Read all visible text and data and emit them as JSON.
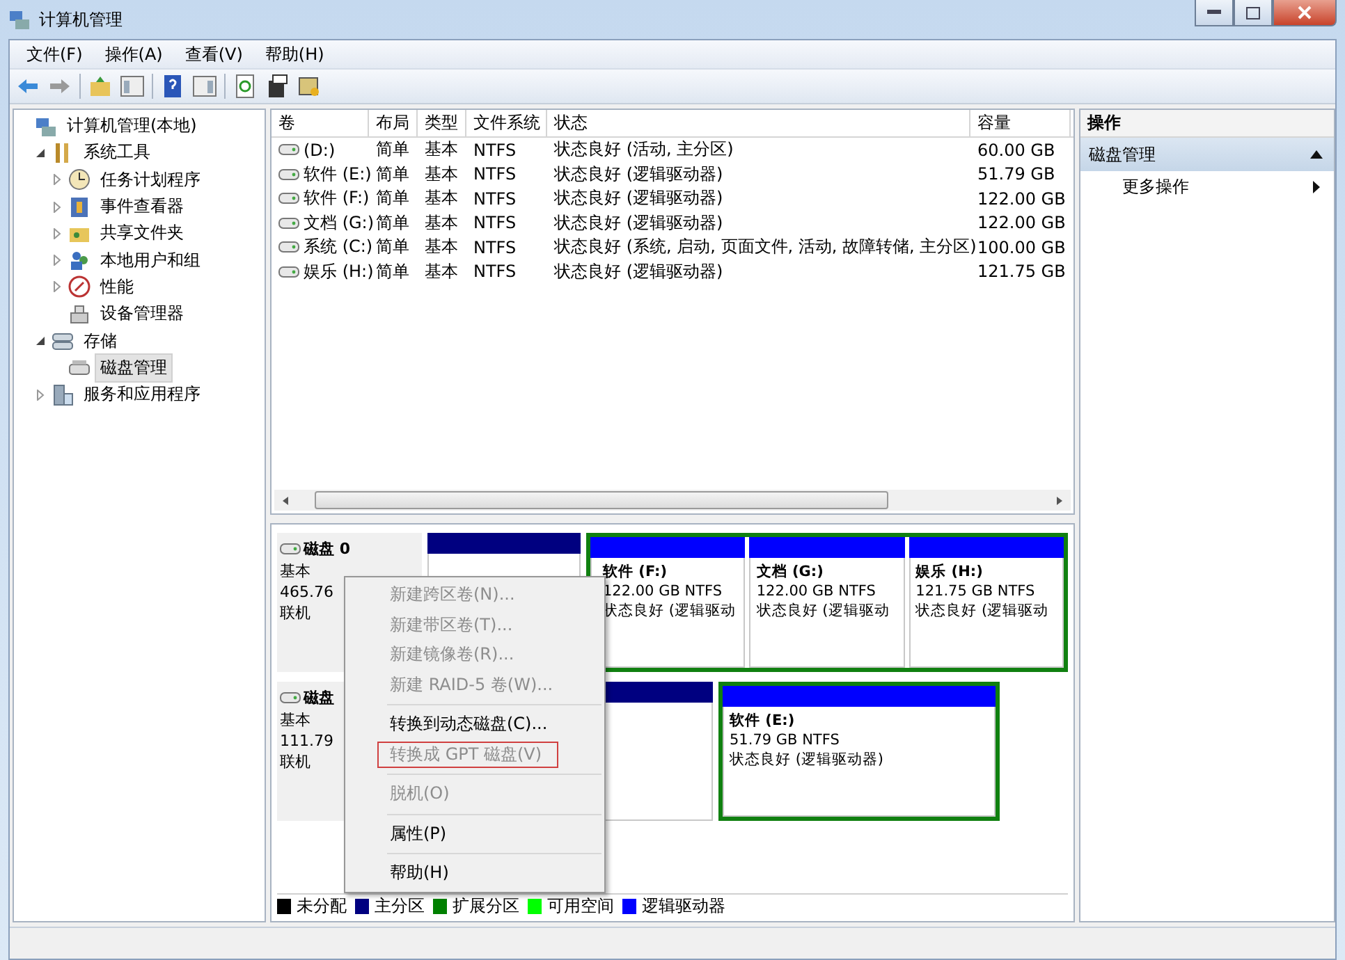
{
  "window": {
    "title": "计算机管理"
  },
  "menu_bar": [
    "文件(F)",
    "操作(A)",
    "查看(V)",
    "帮助(H)"
  ],
  "tree": [
    {
      "label": "计算机管理(本地)",
      "selected": false,
      "children": [
        {
          "label": "系统工具",
          "expanded": true,
          "selected": false,
          "children": [
            {
              "label": "任务计划程序",
              "expanded": false,
              "selected": false
            },
            {
              "label": "事件查看器",
              "expanded": false,
              "selected": false
            },
            {
              "label": "共享文件夹",
              "expanded": false,
              "selected": false
            },
            {
              "label": "本地用户和组",
              "expanded": false,
              "selected": false
            },
            {
              "label": "性能",
              "expanded": false,
              "selected": false
            },
            {
              "label": "设备管理器",
              "selected": false
            }
          ]
        },
        {
          "label": "存储",
          "expanded": true,
          "selected": false,
          "children": [
            {
              "label": "磁盘管理",
              "selected": true
            }
          ]
        },
        {
          "label": "服务和应用程序",
          "expanded": false,
          "selected": false
        }
      ]
    }
  ],
  "volume_table": {
    "columns": [
      "卷",
      "布局",
      "类型",
      "文件系统",
      "状态",
      "容量"
    ],
    "rows": [
      [
        "(D:)",
        "简单",
        "基本",
        "NTFS",
        "状态良好 (活动, 主分区)",
        "60.00 GB"
      ],
      [
        "软件 (E:)",
        "简单",
        "基本",
        "NTFS",
        "状态良好 (逻辑驱动器)",
        "51.79 GB"
      ],
      [
        "软件 (F:)",
        "简单",
        "基本",
        "NTFS",
        "状态良好 (逻辑驱动器)",
        "122.00 GB"
      ],
      [
        "文档 (G:)",
        "简单",
        "基本",
        "NTFS",
        "状态良好 (逻辑驱动器)",
        "122.00 GB"
      ],
      [
        "系统 (C:)",
        "简单",
        "基本",
        "NTFS",
        "状态良好 (系统, 启动, 页面文件, 活动, 故障转储, 主分区)",
        "100.00 GB"
      ],
      [
        "娱乐 (H:)",
        "简单",
        "基本",
        "NTFS",
        "状态良好 (逻辑驱动器)",
        "121.75 GB"
      ]
    ]
  },
  "disks": [
    {
      "name": "磁盘 0",
      "type": "基本",
      "size": "465.76",
      "status": "联机",
      "partitions": [
        {
          "kind": "primary"
        },
        {
          "kind": "extended",
          "children": [
            {
              "name": "软件 (F:)",
              "size": "122.00 GB NTFS",
              "status": "状态良好 (逻辑驱动"
            },
            {
              "name": "文档 (G:)",
              "size": "122.00 GB NTFS",
              "status": "状态良好 (逻辑驱动"
            },
            {
              "name": "娱乐 (H:)",
              "size": "121.75 GB NTFS",
              "status": "状态良好 (逻辑驱动"
            }
          ]
        }
      ]
    },
    {
      "name": "磁盘",
      "type": "基本",
      "size": "111.79",
      "status": "联机",
      "partitions": [
        {
          "kind": "primary"
        },
        {
          "kind": "extended",
          "children": [
            {
              "name": "软件 (E:)",
              "size": "51.79 GB NTFS",
              "status": "状态良好 (逻辑驱动器)"
            }
          ]
        }
      ]
    }
  ],
  "legend": [
    {
      "label": "未分配",
      "color": "#000000"
    },
    {
      "label": "主分区",
      "color": "#000080"
    },
    {
      "label": "扩展分区",
      "color": "#008000"
    },
    {
      "label": "可用空间",
      "color": "#00ff00"
    },
    {
      "label": "逻辑驱动器",
      "color": "#0000ff"
    }
  ],
  "context_menu": [
    {
      "kind": "item",
      "label": "新建跨区卷(N)...",
      "disabled": true,
      "highlighted": false
    },
    {
      "kind": "item",
      "label": "新建带区卷(T)...",
      "disabled": true,
      "highlighted": false
    },
    {
      "kind": "item",
      "label": "新建镜像卷(R)...",
      "disabled": true,
      "highlighted": false
    },
    {
      "kind": "item",
      "label": "新建 RAID-5 卷(W)...",
      "disabled": true,
      "highlighted": false
    },
    {
      "kind": "separator"
    },
    {
      "kind": "item",
      "label": "转换到动态磁盘(C)...",
      "disabled": false,
      "highlighted": false
    },
    {
      "kind": "item",
      "label": "转换成 GPT 磁盘(V)",
      "disabled": true,
      "highlighted": true
    },
    {
      "kind": "separator"
    },
    {
      "kind": "item",
      "label": "脱机(O)",
      "disabled": true,
      "highlighted": false
    },
    {
      "kind": "separator"
    },
    {
      "kind": "item",
      "label": "属性(P)",
      "disabled": false,
      "highlighted": false
    },
    {
      "kind": "separator"
    },
    {
      "kind": "item",
      "label": "帮助(H)",
      "disabled": false,
      "highlighted": false
    }
  ],
  "actions": {
    "header": "操作",
    "section": {
      "label": "磁盘管理",
      "expanded": true
    },
    "items": [
      "更多操作"
    ]
  }
}
